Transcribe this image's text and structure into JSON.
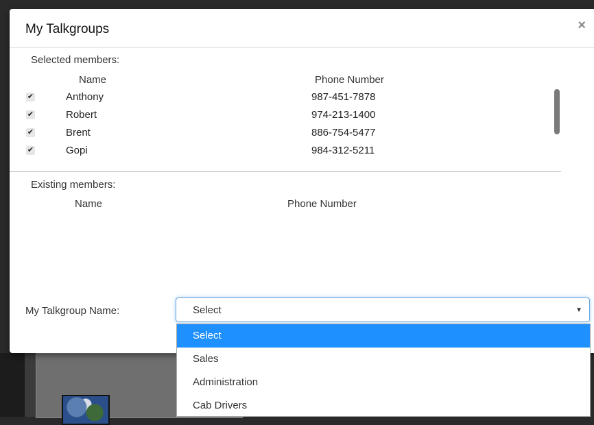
{
  "dialog": {
    "title": "My Talkgroups",
    "close_glyph": "×"
  },
  "selected_members": {
    "label": "Selected members:",
    "headers": {
      "name": "Name",
      "phone": "Phone Number"
    },
    "rows": [
      {
        "name": "Anthony",
        "phone": "987-451-7878",
        "checked": true
      },
      {
        "name": "Robert",
        "phone": "974-213-1400",
        "checked": true
      },
      {
        "name": "Brent",
        "phone": "886-754-5477",
        "checked": true
      },
      {
        "name": "Gopi",
        "phone": "984-312-5211",
        "checked": true
      }
    ]
  },
  "existing_members": {
    "label": "Existing members:",
    "headers": {
      "name": "Name",
      "phone": "Phone Number"
    }
  },
  "talkgroup_name": {
    "label": "My Talkgroup Name:",
    "value": "Select",
    "options": [
      "Select",
      "Sales",
      "Administration",
      "Cab Drivers"
    ],
    "highlighted": "Select"
  },
  "colors": {
    "highlight": "#1e90ff",
    "focus_border": "#66a3e0"
  }
}
